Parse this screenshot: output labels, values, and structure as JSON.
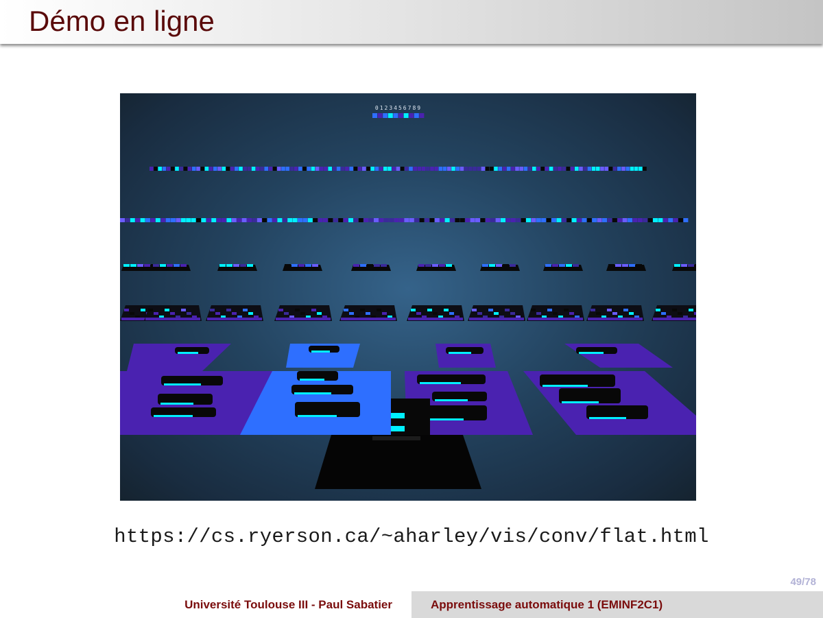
{
  "slide": {
    "title": "Démo en ligne",
    "url": "https://cs.ryerson.ca/~aharley/vis/conv/flat.html",
    "page_number": "49/78"
  },
  "figure": {
    "output_labels": "0123456789",
    "colors": {
      "background_center": "#35638a",
      "background_edge": "#15232f",
      "cyan": "#00f0ff",
      "blue": "#2e6fff",
      "purple": "#4a22b0",
      "black": "#080808"
    }
  },
  "footer": {
    "institution": "Université Toulouse III - Paul Sabatier",
    "course": "Apprentissage automatique 1 (EMINF2C1)"
  }
}
